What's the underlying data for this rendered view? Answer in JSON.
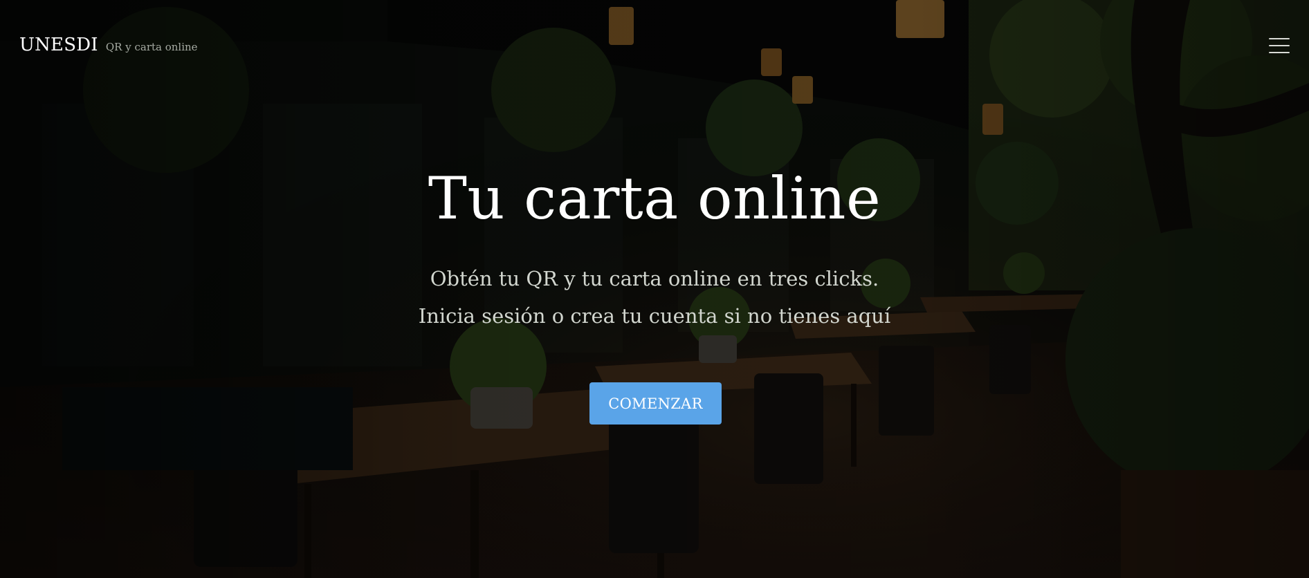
{
  "brand": {
    "name": "UNESDI",
    "tagline": "QR y carta online"
  },
  "header": {
    "menu_icon": "hamburger-menu-icon"
  },
  "hero": {
    "title": "Tu carta online",
    "subtitle_line1": "Obtén tu QR y tu carta online en tres clicks.",
    "subtitle_line2": "Inicia sesión o crea tu cuenta si no tienes aquí",
    "cta_label": "COMENZAR",
    "background": "dark-restaurant-terrace-photo"
  },
  "colors": {
    "cta_background": "#5aa4e8",
    "text_primary": "#ffffff",
    "text_secondary": "#d2d6cf",
    "tagline": "#a6aba3"
  }
}
